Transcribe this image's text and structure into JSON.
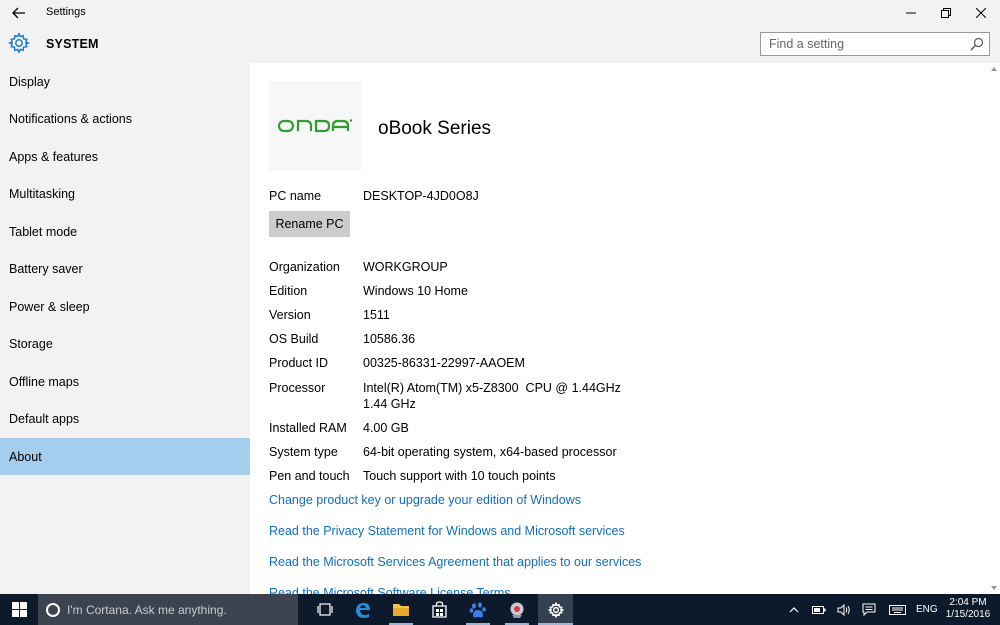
{
  "window": {
    "title": "Settings",
    "back_icon": "back-arrow-icon",
    "minimize_glyph": "—",
    "restore_glyph": "❐",
    "close_glyph": "✕"
  },
  "header": {
    "icon": "gear-icon",
    "title": "SYSTEM",
    "search_placeholder": "Find a setting"
  },
  "sidebar": {
    "items": [
      {
        "label": "Display"
      },
      {
        "label": "Notifications & actions"
      },
      {
        "label": "Apps & features"
      },
      {
        "label": "Multitasking"
      },
      {
        "label": "Tablet mode"
      },
      {
        "label": "Battery saver"
      },
      {
        "label": "Power & sleep"
      },
      {
        "label": "Storage"
      },
      {
        "label": "Offline maps"
      },
      {
        "label": "Default apps"
      },
      {
        "label": "About"
      }
    ],
    "selected_index": 10,
    "selected_color": "#a5cdee"
  },
  "about": {
    "logo_text": "ONDA",
    "logo_color": "#2f9e2c",
    "series": "oBook Series",
    "pc_name_label": "PC name",
    "pc_name": "DESKTOP-4JD0O8J",
    "rename_button": "Rename PC",
    "specs": [
      {
        "label": "Organization",
        "value": "WORKGROUP"
      },
      {
        "label": "Edition",
        "value": "Windows 10 Home"
      },
      {
        "label": "Version",
        "value": "1511"
      },
      {
        "label": "OS Build",
        "value": "10586.36"
      },
      {
        "label": "Product ID",
        "value": "00325-86331-22997-AAOEM"
      },
      {
        "label": "Processor",
        "value": "Intel(R) Atom(TM) x5-Z8300  CPU @ 1.44GHz",
        "value2": "1.44 GHz"
      },
      {
        "label": "Installed RAM",
        "value": "4.00 GB"
      },
      {
        "label": "System type",
        "value": "64-bit operating system, x64-based processor"
      },
      {
        "label": "Pen and touch",
        "value": "Touch support with 10 touch points"
      }
    ],
    "links": [
      "Change product key or upgrade your edition of Windows",
      "Read the Privacy Statement for Windows and Microsoft services",
      "Read the Microsoft Services Agreement that applies to our services",
      "Read the Microsoft Software License Terms"
    ],
    "link_color": "#0f6fc6"
  },
  "taskbar": {
    "cortana_placeholder": "I'm Cortana. Ask me anything.",
    "apps": [
      "task-view-icon",
      "edge-icon",
      "file-explorer-icon",
      "store-icon",
      "baidu-icon",
      "app-icon",
      "settings-icon"
    ],
    "language": "ENG",
    "time": "2:04 PM",
    "date": "1/15/2016",
    "background": "#0d1a2b"
  }
}
